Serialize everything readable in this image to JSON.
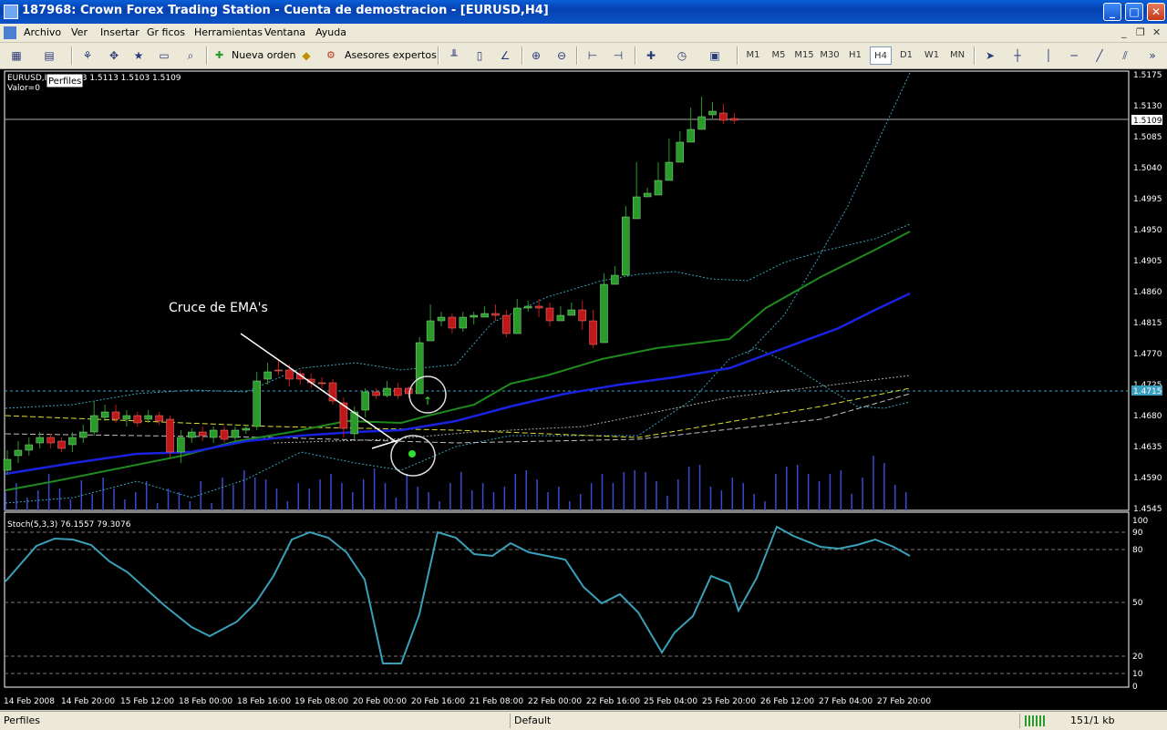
{
  "window": {
    "title": "187968: Crown Forex Trading Station - Cuenta de demostracion - [EURUSD,H4]"
  },
  "menu": [
    "Archivo",
    "Ver",
    "Insertar",
    "Gr ficos",
    "Herramientas",
    "Ventana",
    "Ayuda"
  ],
  "toolbar": {
    "new_order": "Nueva orden",
    "experts": "Asesores expertos"
  },
  "timeframes": [
    "M1",
    "M5",
    "M15",
    "M30",
    "H1",
    "H4",
    "D1",
    "W1",
    "MN"
  ],
  "active_timeframe": "H4",
  "chart": {
    "info": "EURUSD,H4  1.5113 1.5113 1.5103 1.5109",
    "profiles_tip": "Perfiles",
    "valor": "Valor=0",
    "annotation": "Cruce de EMA's",
    "price_labels": [
      "1.5175",
      "1.5130",
      "1.5109",
      "1.5085",
      "1.5040",
      "1.4995",
      "1.4950",
      "1.4905",
      "1.4860",
      "1.4815",
      "1.4770",
      "1.4725",
      "1.4715",
      "1.4680",
      "1.4635",
      "1.4590",
      "1.4545"
    ],
    "current_price": "1.5109",
    "level_price": "1.4715",
    "time_labels": [
      "14 Feb 2008",
      "14 Feb 20:00",
      "15 Feb 12:00",
      "18 Feb 00:00",
      "18 Feb 16:00",
      "19 Feb 08:00",
      "20 Feb 00:00",
      "20 Feb 16:00",
      "21 Feb 08:00",
      "22 Feb 00:00",
      "22 Feb 16:00",
      "25 Feb 04:00",
      "25 Feb 20:00",
      "26 Feb 12:00",
      "27 Feb 04:00",
      "27 Feb 20:00"
    ],
    "stoch_label": "Stoch(5,3,3) 76.1557 79.3076",
    "stoch_levels": [
      "100",
      "90",
      "80",
      "50",
      "20",
      "10",
      "0"
    ]
  },
  "colors": {
    "bull": "#2a9a2a",
    "bear": "#c01818",
    "ema_fast": "#1e8a1e",
    "ema_slow": "#1a22e0",
    "stoch": "#3aa0b8",
    "volume": "#3a4ad0"
  },
  "statusbar": {
    "left": "Perfiles",
    "profile": "Default",
    "traffic": "151/1 kb"
  }
}
